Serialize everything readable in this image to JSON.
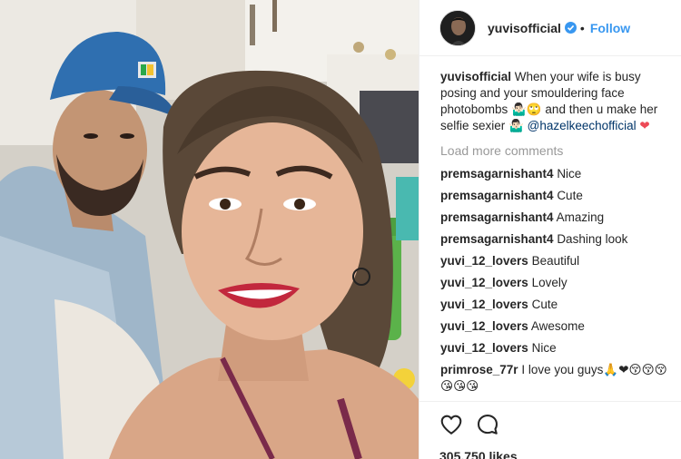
{
  "post": {
    "username": "yuvisofficial",
    "separator": "•",
    "follow_label": "Follow",
    "caption_text": "When your wife is busy posing and your smouldering face photobombs 🤷🏻‍♂️🙄 and then u make her selfie sexier 🤷🏻‍♂️",
    "caption_mention": "@hazelkeechofficial",
    "caption_heart": "❤",
    "load_more": "Load more comments",
    "likes": "305,750 likes"
  },
  "comments": [
    {
      "user": "premsagarnishant4",
      "text": "Nice"
    },
    {
      "user": "premsagarnishant4",
      "text": "Cute"
    },
    {
      "user": "premsagarnishant4",
      "text": "Amazing"
    },
    {
      "user": "premsagarnishant4",
      "text": "Dashing look"
    },
    {
      "user": "yuvi_12_lovers",
      "text": "Beautiful"
    },
    {
      "user": "yuvi_12_lovers",
      "text": "Lovely"
    },
    {
      "user": "yuvi_12_lovers",
      "text": "Cute"
    },
    {
      "user": "yuvi_12_lovers",
      "text": "Awesome"
    },
    {
      "user": "yuvi_12_lovers",
      "text": "Nice"
    },
    {
      "user": "primrose_77r",
      "text": "I love you guys🙏❤😚😚😚😘😘😘"
    }
  ],
  "icons": {
    "like": "heart-outline-icon",
    "comment": "speech-bubble-icon",
    "verified": "verified-badge-icon"
  },
  "colors": {
    "follow": "#3897f0",
    "verified": "#3897f0",
    "muted": "#999999",
    "text": "#262626"
  }
}
